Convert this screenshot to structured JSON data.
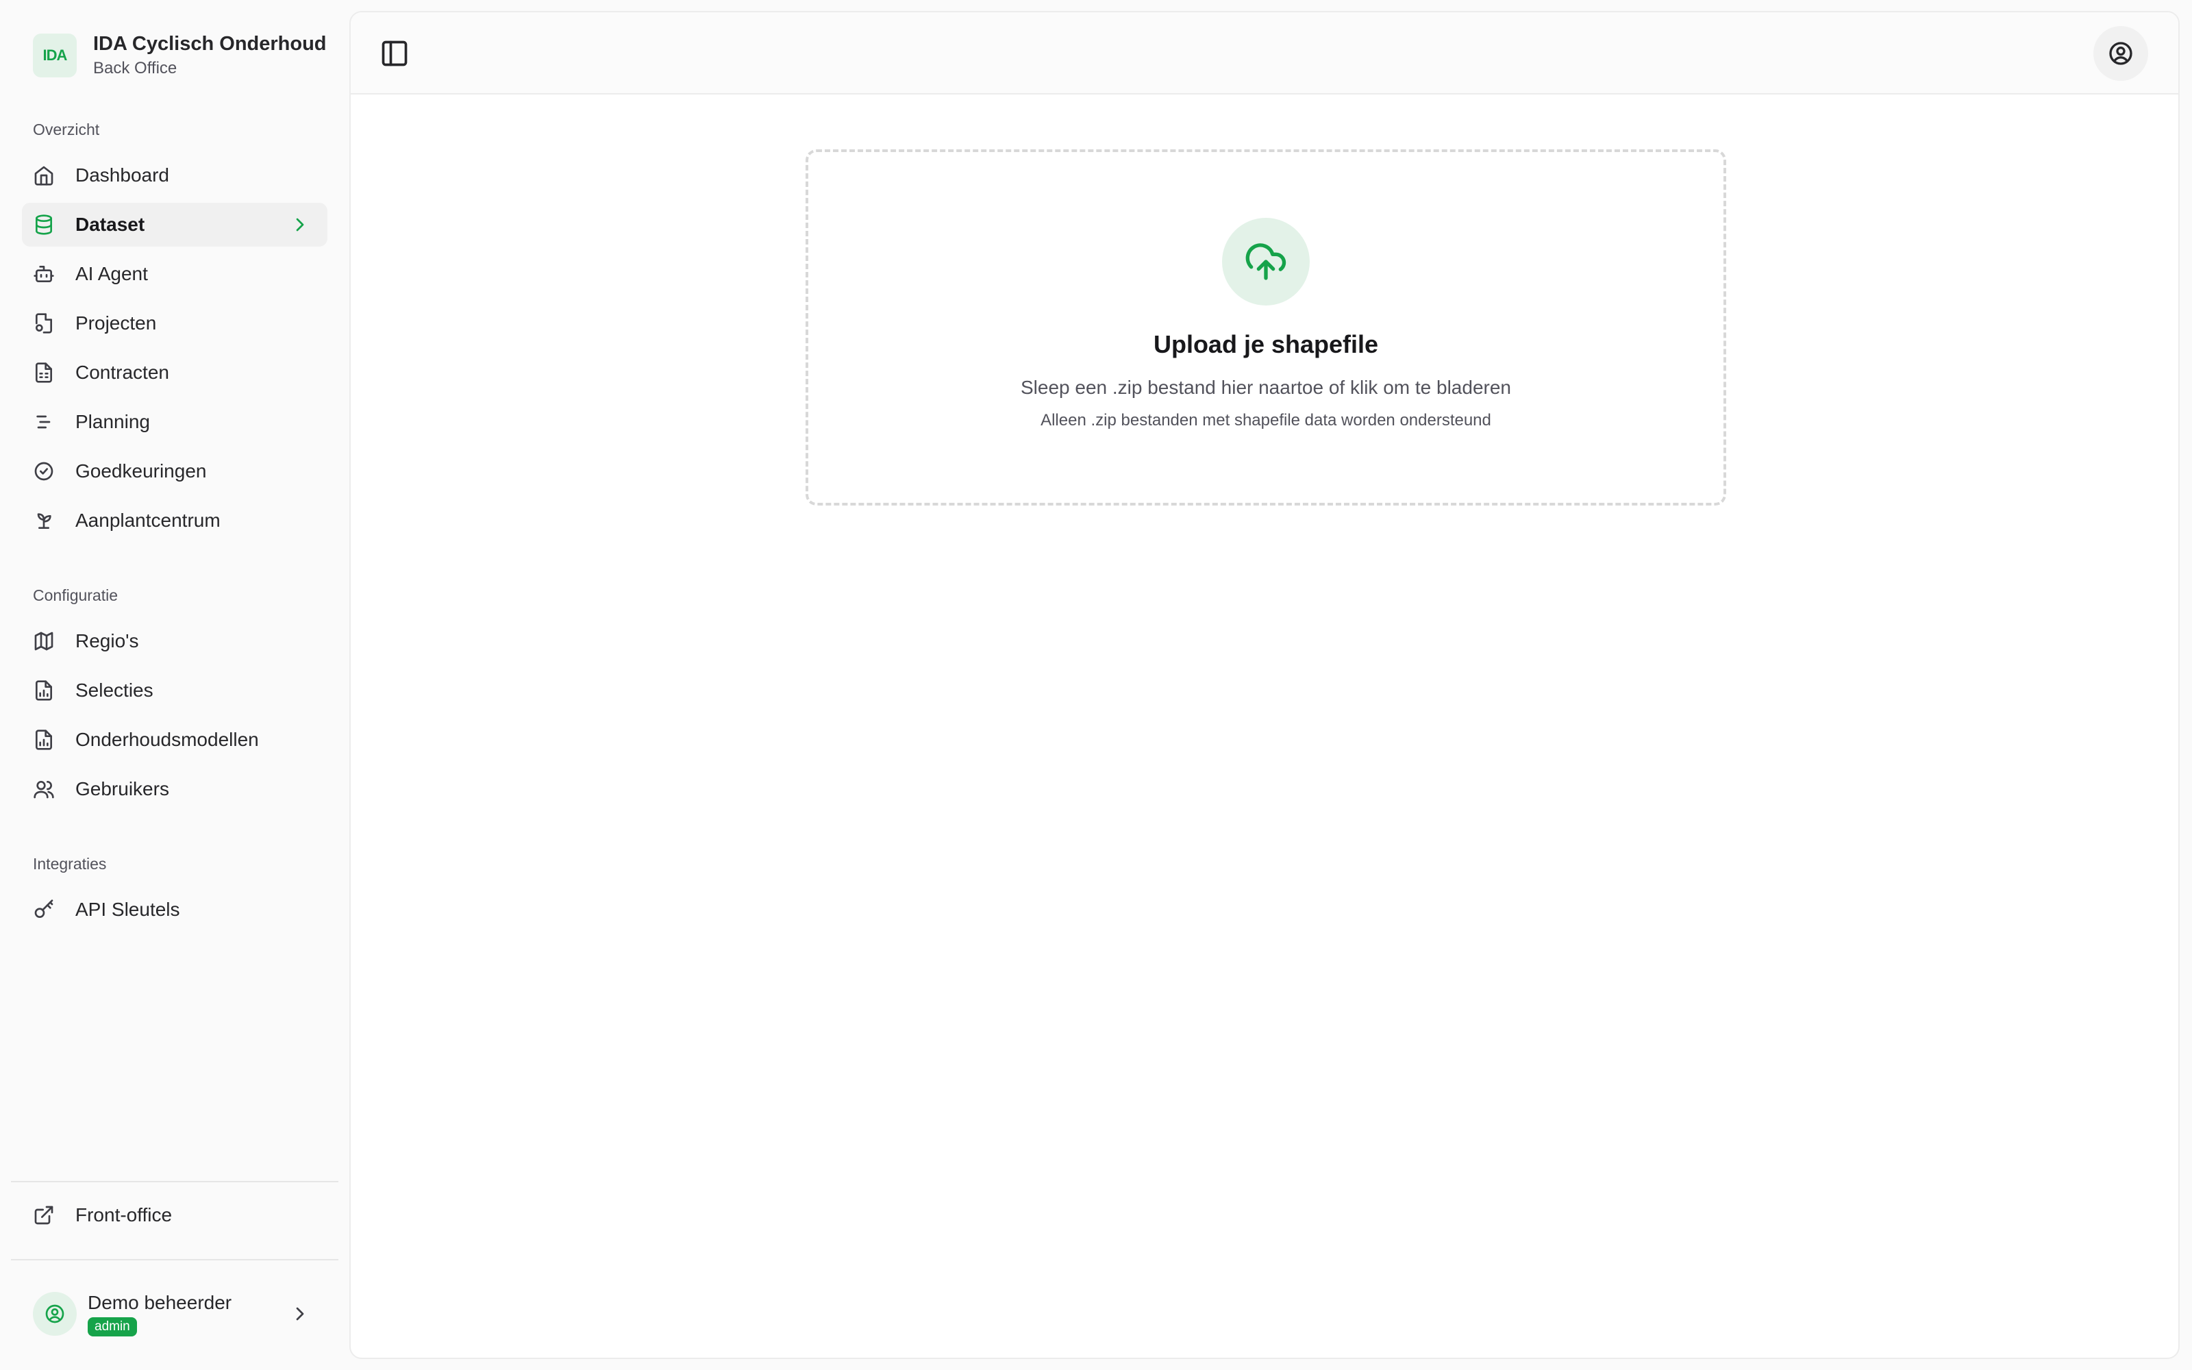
{
  "brand": {
    "logo_text": "IDA",
    "title": "IDA Cyclisch Onderhoud",
    "subtitle": "Back Office"
  },
  "sidebar": {
    "groups": [
      {
        "label": "Overzicht",
        "items": [
          {
            "label": "Dashboard",
            "icon": "home-icon"
          },
          {
            "label": "Dataset",
            "icon": "database-icon",
            "active": true
          },
          {
            "label": "AI Agent",
            "icon": "bot-icon"
          },
          {
            "label": "Projecten",
            "icon": "file-cog-icon"
          },
          {
            "label": "Contracten",
            "icon": "file-spreadsheet-icon"
          },
          {
            "label": "Planning",
            "icon": "gantt-icon"
          },
          {
            "label": "Goedkeuringen",
            "icon": "check-circle-icon"
          },
          {
            "label": "Aanplantcentrum",
            "icon": "sprout-icon"
          }
        ]
      },
      {
        "label": "Configuratie",
        "items": [
          {
            "label": "Regio's",
            "icon": "map-icon"
          },
          {
            "label": "Selecties",
            "icon": "file-chart-icon"
          },
          {
            "label": "Onderhoudsmodellen",
            "icon": "file-chart-icon"
          },
          {
            "label": "Gebruikers",
            "icon": "users-icon"
          }
        ]
      },
      {
        "label": "Integraties",
        "items": [
          {
            "label": "API Sleutels",
            "icon": "key-icon"
          }
        ]
      }
    ],
    "footer_link": {
      "label": "Front-office",
      "icon": "external-link-icon"
    },
    "user": {
      "name": "Demo beheerder",
      "role": "admin"
    }
  },
  "upload": {
    "title": "Upload je shapefile",
    "description": "Sleep een .zip bestand hier naartoe of klik om te bladeren",
    "note": "Alleen .zip bestanden met shapefile data worden ondersteund",
    "icon": "cloud-upload-icon"
  },
  "colors": {
    "accent": "#16a34a",
    "accent_soft": "#e3f2e8",
    "text": "#18181b",
    "muted": "#52525b"
  }
}
